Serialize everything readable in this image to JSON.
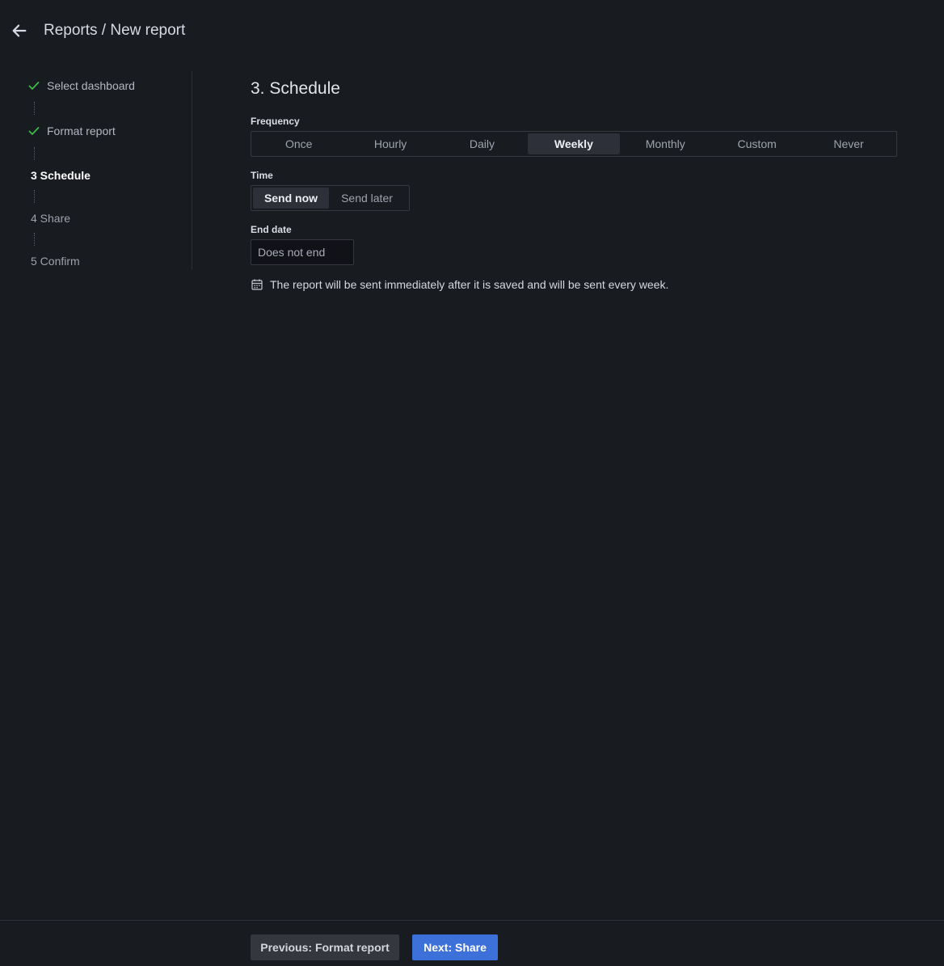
{
  "header": {
    "back_icon": "arrow-left-icon",
    "title": "Reports / New report"
  },
  "stepper": {
    "steps": [
      {
        "label": "Select dashboard",
        "status": "done",
        "icon": "check-icon"
      },
      {
        "label": "Format report",
        "status": "done",
        "icon": "check-icon"
      },
      {
        "label": "3 Schedule",
        "status": "active"
      },
      {
        "label": "4 Share",
        "status": "pending"
      },
      {
        "label": "5 Confirm",
        "status": "pending"
      }
    ]
  },
  "main": {
    "section_title": "3. Schedule",
    "frequency": {
      "label": "Frequency",
      "options": [
        "Once",
        "Hourly",
        "Daily",
        "Weekly",
        "Monthly",
        "Custom",
        "Never"
      ],
      "selected": "Weekly"
    },
    "time": {
      "label": "Time",
      "options": [
        "Send now",
        "Send later"
      ],
      "selected": "Send now"
    },
    "end_date": {
      "label": "End date",
      "placeholder": "Does not end"
    },
    "info": {
      "icon": "calendar-icon",
      "text": "The report will be sent immediately after it is saved and will be sent every week."
    }
  },
  "footer": {
    "previous_label": "Previous: Format report",
    "next_label": "Next: Share"
  },
  "colors": {
    "background": "#181b1f",
    "check": "#3fb950",
    "primary": "#3d71d9"
  }
}
